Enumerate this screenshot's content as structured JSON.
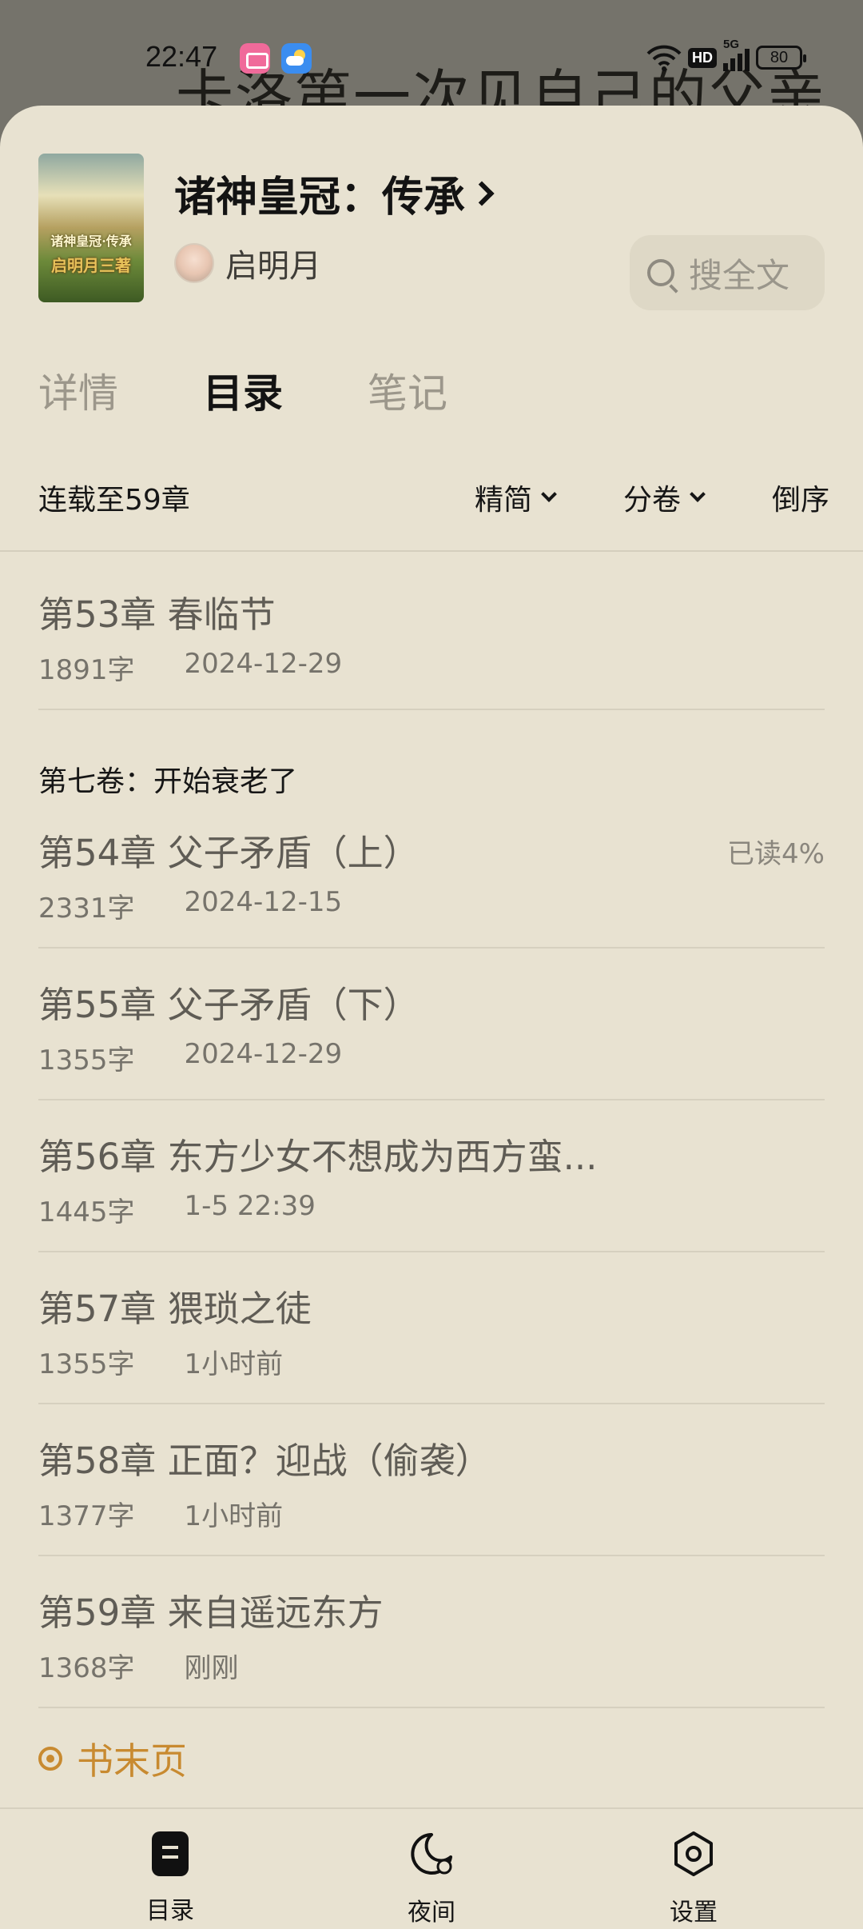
{
  "status_bar": {
    "time": "22:47",
    "hd": "HD",
    "network": "5G",
    "battery": "80"
  },
  "background_text": "卡洛第一次见自己的父亲",
  "book": {
    "title": "诸神皇冠：传承",
    "author": "启明月",
    "cover_title": "诸神皇冠·传承",
    "cover_subtitle": "启明月三著"
  },
  "search": {
    "label": "搜全文"
  },
  "tabs": [
    {
      "label": "详情",
      "active": false
    },
    {
      "label": "目录",
      "active": true
    },
    {
      "label": "笔记",
      "active": false
    }
  ],
  "toolbar": {
    "serial_status": "连载至59章",
    "simplify": "精简",
    "volumes": "分卷",
    "reverse": "倒序"
  },
  "chapters_before": [
    {
      "title": "第53章 春临节",
      "words": "1891字",
      "date": "2024-12-29"
    }
  ],
  "volume": {
    "title": "第七卷：开始衰老了"
  },
  "chapters": [
    {
      "title": "第54章 父子矛盾（上）",
      "words": "2331字",
      "date": "2024-12-15",
      "progress": "已读4%"
    },
    {
      "title": "第55章 父子矛盾（下）",
      "words": "1355字",
      "date": "2024-12-29",
      "progress": ""
    },
    {
      "title": "第56章 东方少女不想成为西方蛮...",
      "words": "1445字",
      "date": "1-5 22:39",
      "progress": ""
    },
    {
      "title": "第57章 猥琐之徒",
      "words": "1355字",
      "date": "1小时前",
      "progress": ""
    },
    {
      "title": "第58章 正面？迎战（偷袭）",
      "words": "1377字",
      "date": "1小时前",
      "progress": ""
    },
    {
      "title": "第59章 来自遥远东方",
      "words": "1368字",
      "date": "刚刚",
      "progress": ""
    }
  ],
  "book_end": {
    "label": "书末页"
  },
  "bottom_nav": {
    "toc": "目录",
    "night": "夜间",
    "settings": "设置"
  },
  "colors": {
    "sheet_bg": "#e8e2d1",
    "accent": "#c88a30",
    "dim_bg": "#75736b"
  }
}
